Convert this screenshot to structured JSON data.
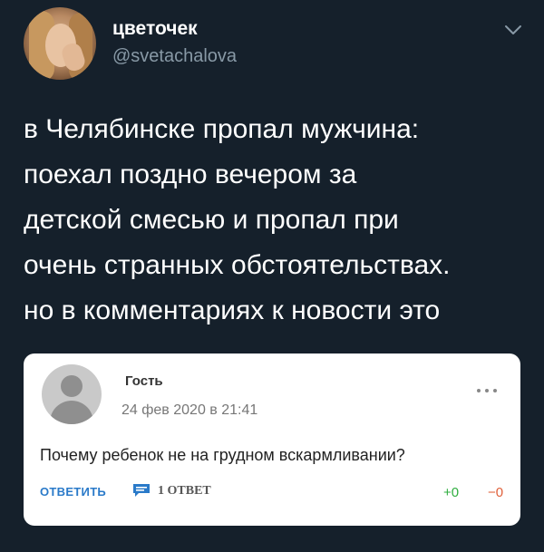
{
  "user": {
    "display_name": "цветочек",
    "handle": "@svetachalova",
    "menu_icon": "chevron-down-icon"
  },
  "tweet": {
    "lines": [
      "в Челябинске пропал мужчина:",
      "поехал поздно вечером за",
      "детской смесью и пропал при",
      "очень странных обстоятельствах.",
      "но в комментариях к новости это"
    ]
  },
  "comment": {
    "author": "Гость",
    "date": "24 фев 2020 в 21:41",
    "text": "Почему ребенок не на грудном вскармливании?",
    "reply_label": "ОТВЕТИТЬ",
    "replies_count": "1 ОТВЕТ",
    "upvotes": "+0",
    "downvotes": "−0",
    "colors": {
      "reply": "#2a7ac9",
      "upvotes": "#2fae3f",
      "downvotes": "#e0603a"
    }
  }
}
